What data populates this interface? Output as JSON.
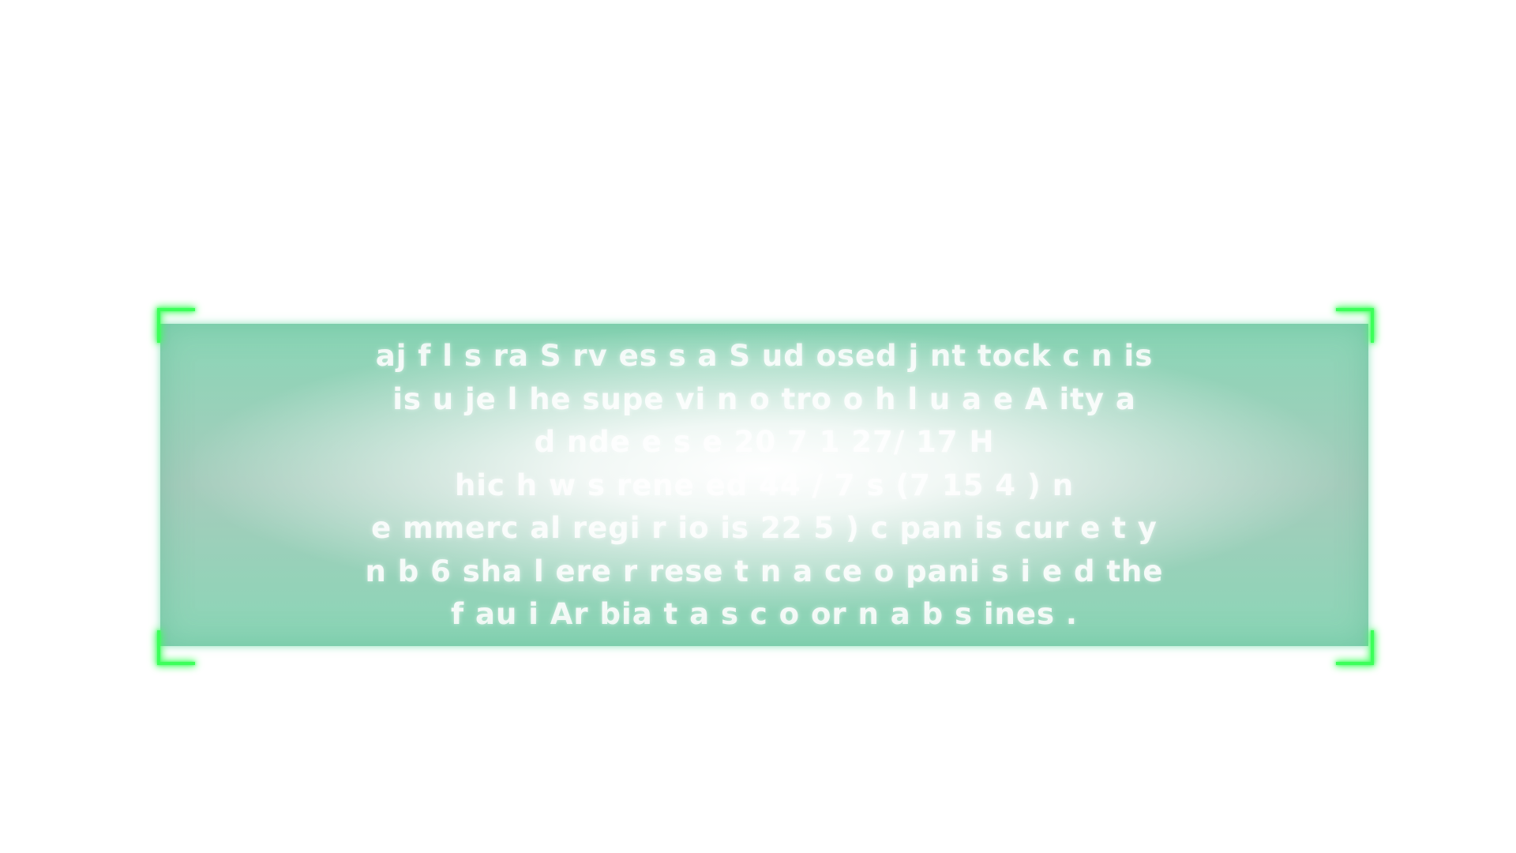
{
  "panel": {
    "accent_color": "#3cff5a",
    "panel_color": "#8ad6b6",
    "lines": [
      "aj   f  l  s  ra      S  rv   es  s  a  S  ud     osed j    nt    tock c          n              is",
      "is   u   je   l      he  supe  vi        n      o  tro  o   h     l     u    a     e  A        ity a",
      "d   nde     e   s     e                               20  7  1                       27/     17 H",
      "hic h  w    s  rene   ed        44  /  7                              s (7      15      4    )    n",
      "e     mmerc  al  regi  r   io            is           22      5  )      c       pan   is  cur  e  t  y",
      "n      b     6  sha       l    ere   r     rese  t    n       a   ce   o   pani   s   i   e     d    the",
      "f   au   i  Ar   bia  t       a   s   c        o    or   n        a        b   s ines  ."
    ]
  },
  "corner_icons": [
    "corner-bracket-top-left",
    "corner-bracket-top-right",
    "corner-bracket-bottom-left",
    "corner-bracket-bottom-right"
  ]
}
